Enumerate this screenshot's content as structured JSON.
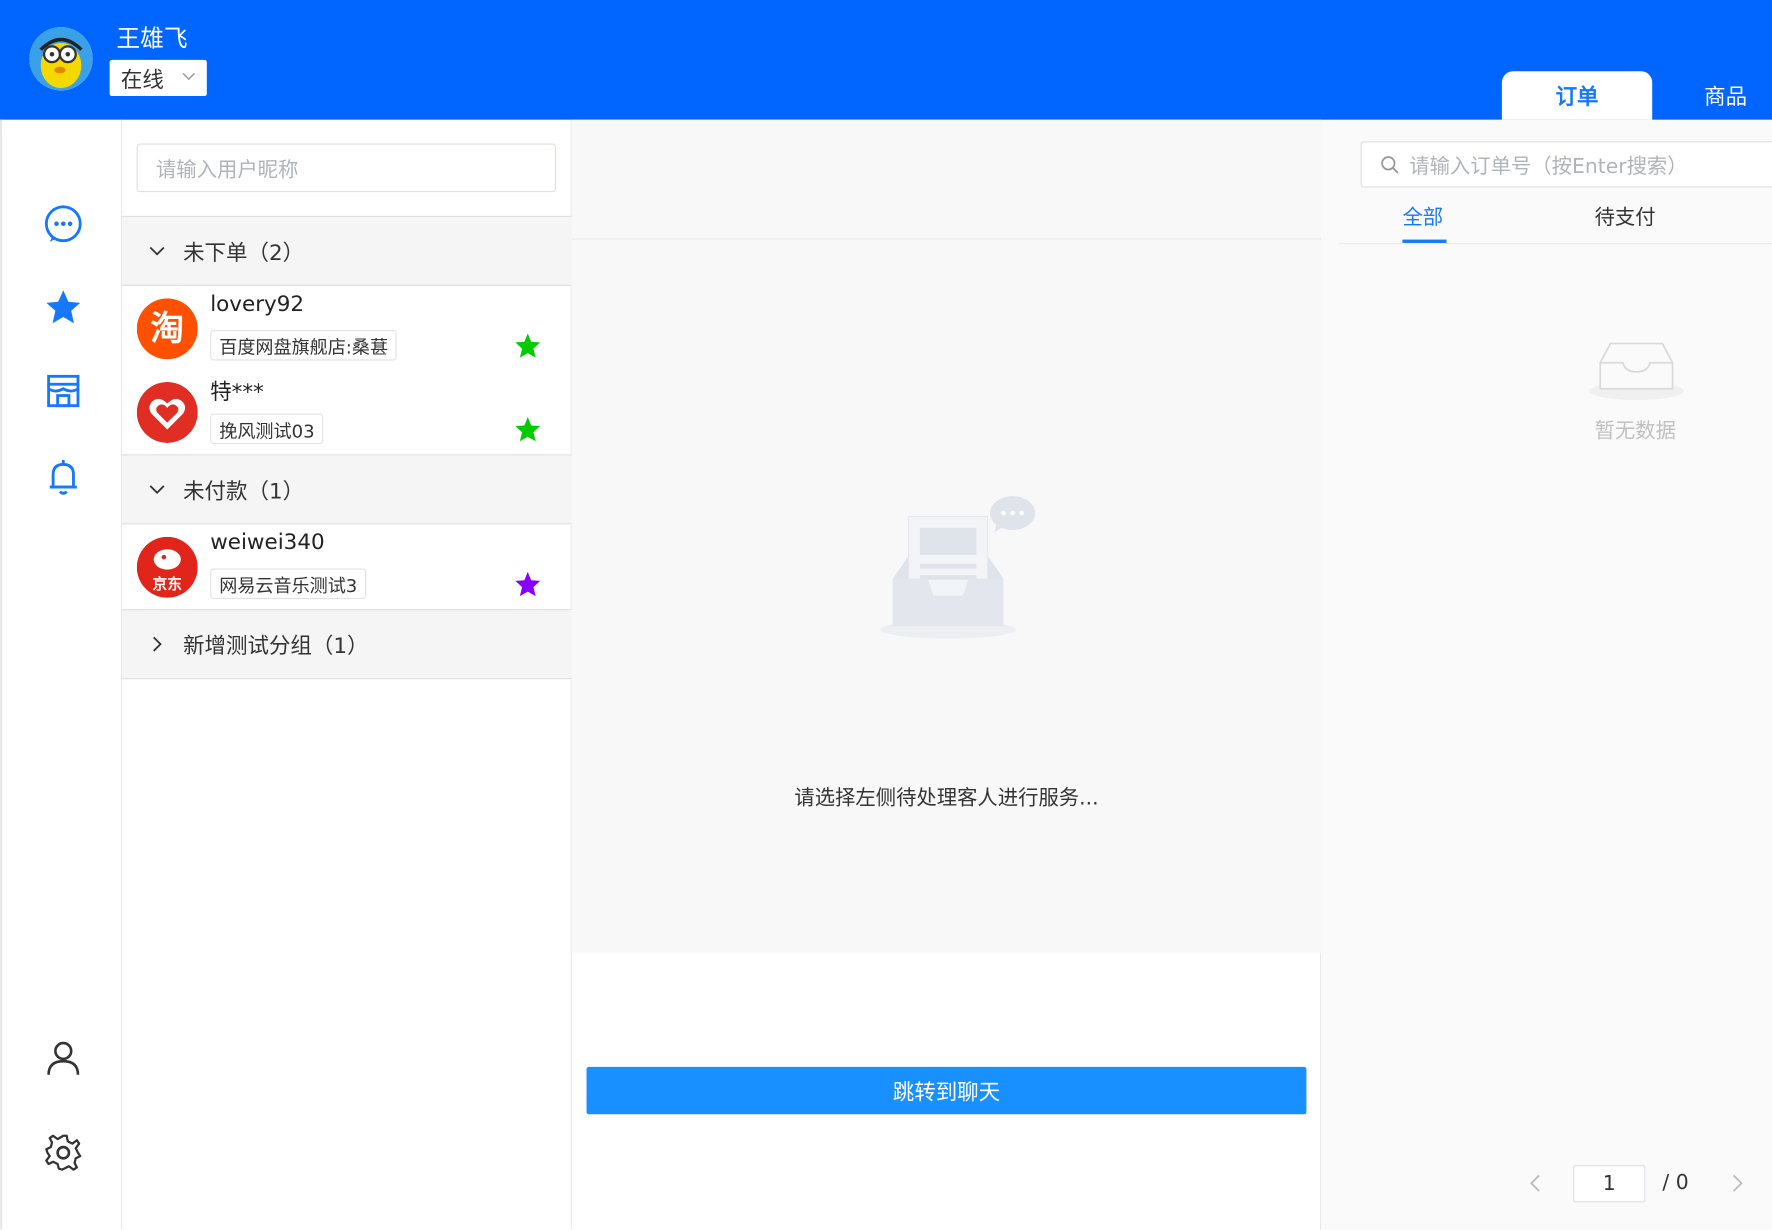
{
  "header": {
    "user_name": "王雄飞",
    "status_value": "在线",
    "tabs": [
      {
        "label": "订单",
        "active": true
      },
      {
        "label": "商品",
        "active": false
      }
    ],
    "brand_color": "#0066ff"
  },
  "leftnav": {
    "icons": [
      "chat-icon",
      "star-icon",
      "store-icon",
      "bell-icon",
      "user-icon",
      "gear-icon"
    ],
    "accent": "#1677ff"
  },
  "customers": {
    "search_placeholder": "请输入用户昵称",
    "groups": [
      {
        "title": "未下单（2）",
        "expanded": true,
        "items": [
          {
            "nick": "lovery92",
            "platform": "淘宝",
            "shop": "百度网盘旗舰店:桑葚",
            "star_color": "#00cc00"
          },
          {
            "nick": "特***",
            "platform": "拼多多",
            "shop": "挽风测试03",
            "star_color": "#00cc00"
          }
        ]
      },
      {
        "title": "未付款（1）",
        "expanded": true,
        "items": [
          {
            "nick": "weiwei340",
            "platform": "京东",
            "shop": "网易云音乐测试3",
            "star_color": "#8a00ff"
          }
        ]
      },
      {
        "title": "新增测试分组（1）",
        "expanded": false,
        "items": []
      }
    ]
  },
  "center": {
    "empty_text": "请选择左侧待处理客人进行服务...",
    "jump_button": "跳转到聊天"
  },
  "orders": {
    "search_placeholder": "请输入订单号（按Enter搜索）",
    "tabs": [
      {
        "label": "全部",
        "active": true
      },
      {
        "label": "待支付",
        "active": false
      }
    ],
    "empty_text": "暂无数据",
    "pager": {
      "current": "1",
      "total": "/ 0"
    }
  }
}
